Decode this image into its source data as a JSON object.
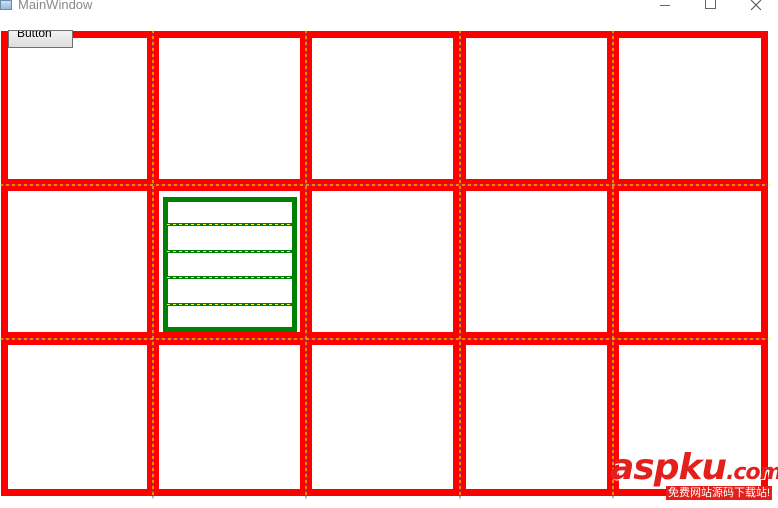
{
  "window": {
    "title": "MainWindow"
  },
  "content": {
    "button_label": "Button"
  },
  "grid": {
    "outer": {
      "rows": 3,
      "columns": 5,
      "border_color": "#ff0000",
      "gridline_color": "#ffff00"
    },
    "inner": {
      "rows": 5,
      "columns": 1,
      "border_color": "#008000",
      "gridline_color": "#ffff00",
      "host_row": 2,
      "host_column": 2
    }
  },
  "watermark": {
    "logo_main": "aspku",
    "logo_tld": ".com",
    "tagline": "免费网站源码下载站!"
  },
  "colors": {
    "accent": "#ff0000",
    "inner_accent": "#008000",
    "watermark": "#e3201b"
  }
}
